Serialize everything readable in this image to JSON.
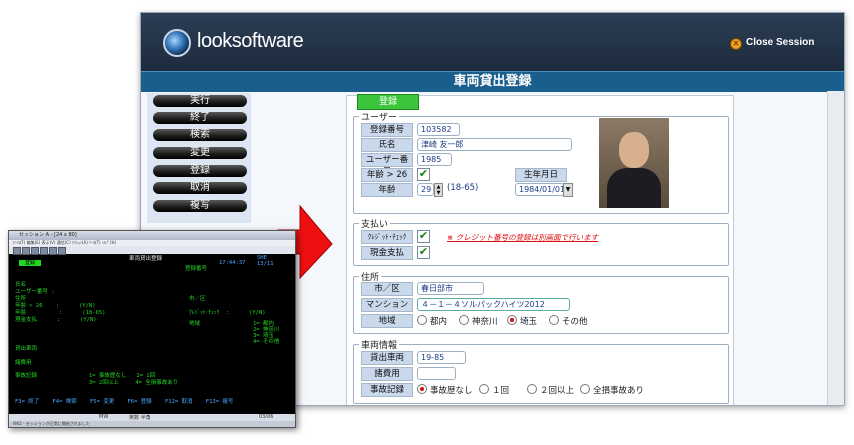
{
  "app": {
    "logo_text": "looksoftware",
    "close_label": "Close Session",
    "page_title": "車両貸出登録"
  },
  "menu": [
    "実行",
    "終了",
    "検索",
    "変更",
    "登録",
    "取消",
    "複写"
  ],
  "form": {
    "mode_badge": "登録",
    "user_section": "ユーザー",
    "reg_no_label": "登録番号",
    "reg_no_value": "103582",
    "name_label": "氏名",
    "name_value": "津崎 友一郎",
    "user_no_label": "ユーザー番号",
    "user_no_value": "1985",
    "age_over_label": "年齢 > 26",
    "birthdate_label": "生年月日",
    "age_label": "年齢",
    "age_value": "29",
    "age_range": "(18-65)",
    "birthdate_value": "1984/01/01",
    "payment_section": "支払い",
    "credit_label": "ｸﾚｼﾞｯﾄ･ﾁｪｯｸ",
    "credit_note": "※ クレジット番号の登録は別画面で行います",
    "cash_label": "現金支払",
    "address_section": "住所",
    "city_label": "市／区",
    "city_value": "春日部市",
    "mansion_label": "マンション",
    "mansion_value": "４－１－４ソルパックハイツ2012",
    "region_label": "地域",
    "region_options": [
      "都内",
      "神奈川",
      "埼玉",
      "その他"
    ],
    "region_selected": 2,
    "vehicle_section": "車両情報",
    "loan_vehicle_label": "貸出車両",
    "loan_vehicle_value": "19-85",
    "expense_label": "諸費用",
    "expense_value": "",
    "accident_label": "事故記録",
    "accident_options": [
      "事故歴なし",
      "１回",
      "２回以上",
      "全損事故あり"
    ],
    "accident_selected": 0
  },
  "terminal": {
    "title": "セッション A - [24 x 80]",
    "menu_text": "ﾌｧｲﾙ(F)  編集(E)  表示(V)  通信(C)  ｱｸｼｮﾝ(A)  ﾂｰﾙ(T)  ﾍﾙﾌﾟ(H)",
    "badge": "登録",
    "heading": "車両貸出登録",
    "reg_no_label": "登録番号",
    "time": "17:44:37",
    "date": "13/11",
    "sysname": "SHE",
    "name": "氏名",
    "user_no": "ユーザー番号 :",
    "address": "住所",
    "age_over": "年齢 > 26    :      (Y/N)",
    "age": "年齢          :      (18-65)",
    "cash": "現金支払      :      (Y/N)",
    "city": "市／区",
    "credit": "ｸﾚｼﾞｯﾄ･ﾁｪｯｸ  :      (Y/N)",
    "region": "地域",
    "region_opts": "1= 都内\n2= 神奈川\n3= 埼玉\n4= その他",
    "loan_vehicle": "貸出車両",
    "expense": "諸費用",
    "accident": "事故記録",
    "accident_opts1": "1= 事故歴なし   2= 1回",
    "accident_opts2": "3= 2回以上     4= 全損事故あり",
    "fkeys": "F3= 終了    F4= 検索    F5= 変更    F6= 登録    F12= 取消    F13= 複写",
    "status_left": "MW",
    "status_mid": "英数  半角",
    "status_right": "03/06",
    "status_line2": "I902 - セッションが正常に開始されました"
  }
}
